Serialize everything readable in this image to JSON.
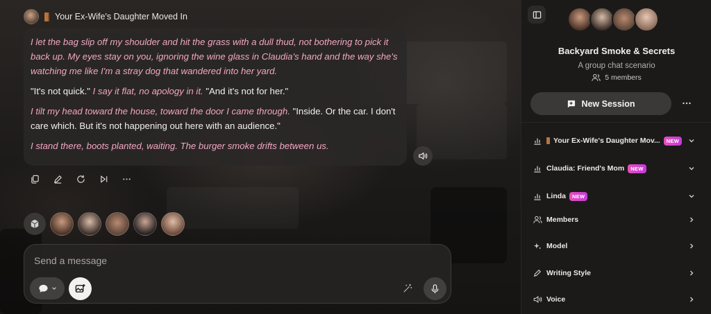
{
  "message": {
    "sender_name": "Your Ex-Wife's Daughter Moved In",
    "paragraphs": [
      [
        {
          "kind": "act",
          "text": "I let the bag slip off my shoulder and hit the grass with a dull thud, not bothering to pick it back up. My eyes stay on you, ignoring the wine glass in Claudia's hand and the way she's watching me like I'm a stray dog that wandered into her yard."
        }
      ],
      [
        {
          "kind": "speech",
          "text": "\"It's not quick.\" "
        },
        {
          "kind": "act",
          "text": "I say it flat, no apology in it. "
        },
        {
          "kind": "speech",
          "text": "\"And it's not for her.\""
        }
      ],
      [
        {
          "kind": "act",
          "text": "I tilt my head toward the house, toward the door I came through. "
        },
        {
          "kind": "speech",
          "text": "\"Inside. Or the car. I don't care which. But it's not happening out here with an audience.\""
        }
      ],
      [
        {
          "kind": "act",
          "text": "I stand there, boots planted, waiting. The burger smoke drifts between us."
        }
      ]
    ],
    "action_icons": [
      "copy-icon",
      "edit-icon",
      "regenerate-icon",
      "skip-icon",
      "more-icon"
    ]
  },
  "composer": {
    "placeholder": "Send a message"
  },
  "panel": {
    "title": "Backyard Smoke & Secrets",
    "subtitle": "A group chat scenario",
    "members_count": "5 members",
    "new_session_label": "New Session",
    "characters": [
      {
        "label": "Your Ex-Wife's Daughter Mov...",
        "badge": "NEW",
        "has_door": true
      },
      {
        "label": "Claudia: Friend's Mom",
        "badge": "NEW",
        "has_door": false
      },
      {
        "label": "Linda",
        "badge": "NEW",
        "has_door": false
      }
    ],
    "menu": [
      {
        "label": "Members",
        "icon": "members-icon"
      },
      {
        "label": "Model",
        "icon": "sparkle-icon"
      },
      {
        "label": "Writing Style",
        "icon": "pen-icon"
      },
      {
        "label": "Voice",
        "icon": "speaker-icon"
      }
    ]
  },
  "colors": {
    "accent_pink": "#f3a6c4",
    "badge_gradient_start": "#e64fbf",
    "badge_gradient_end": "#c43bd6",
    "panel_bg": "#1b1a19"
  }
}
